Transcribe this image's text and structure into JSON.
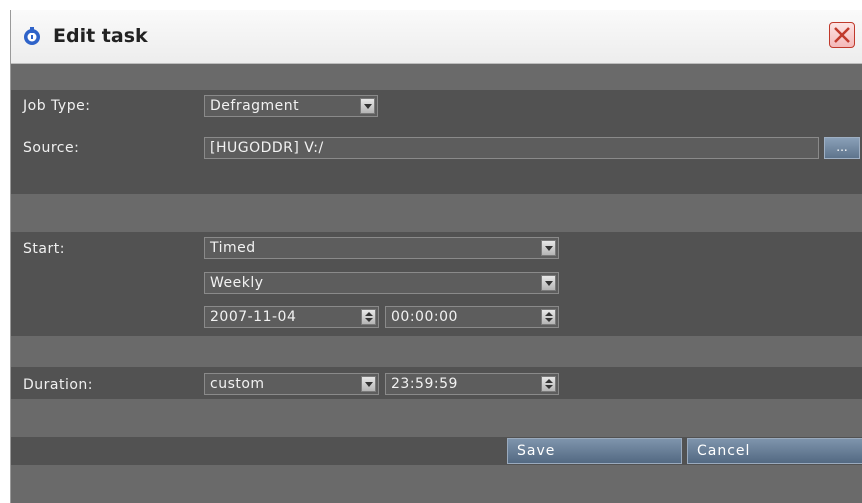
{
  "window": {
    "title": "Edit task"
  },
  "labels": {
    "job_type": "Job Type:",
    "source": "Source:",
    "start": "Start:",
    "duration": "Duration:"
  },
  "fields": {
    "job_type": "Defragment",
    "source": "[HUGODDR] V:/",
    "browse": "...",
    "start_mode": "Timed",
    "recurrence": "Weekly",
    "start_date": "2007-11-04",
    "start_time": "00:00:00",
    "duration_mode": "custom",
    "duration_time": "23:59:59"
  },
  "buttons": {
    "save": "Save",
    "cancel": "Cancel"
  },
  "colors": {
    "accent": "#6a809a",
    "panel": "#525252",
    "band": "#6a6a6a"
  }
}
